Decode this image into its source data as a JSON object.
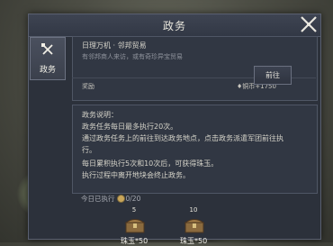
{
  "dialog": {
    "title": "政务"
  },
  "sidebar": {
    "tab_label": "政务"
  },
  "task": {
    "title": "日理万机 · 邻邦贸易",
    "description": "有邻邦商人来访，或有奇珍异宝贸易",
    "reward_label": "奖励",
    "reward_value": "♦铜币+1750",
    "goto_label": "前往"
  },
  "info": {
    "header": "政务说明：",
    "lines": [
      "政务任务每日最多执行20次。",
      "通过政务任务上的前往到达政务地点，点击政务派遣军团前往执",
      "行。",
      "每日累积执行5次和10次后，可获得珠玉。",
      "执行过程中离开地块会终止政务。"
    ]
  },
  "progress": {
    "label": "今日已执行",
    "value": "0/20"
  },
  "chests": [
    {
      "threshold": "5",
      "reward": "珠玉*50"
    },
    {
      "threshold": "10",
      "reward": "珠玉*50"
    }
  ]
}
